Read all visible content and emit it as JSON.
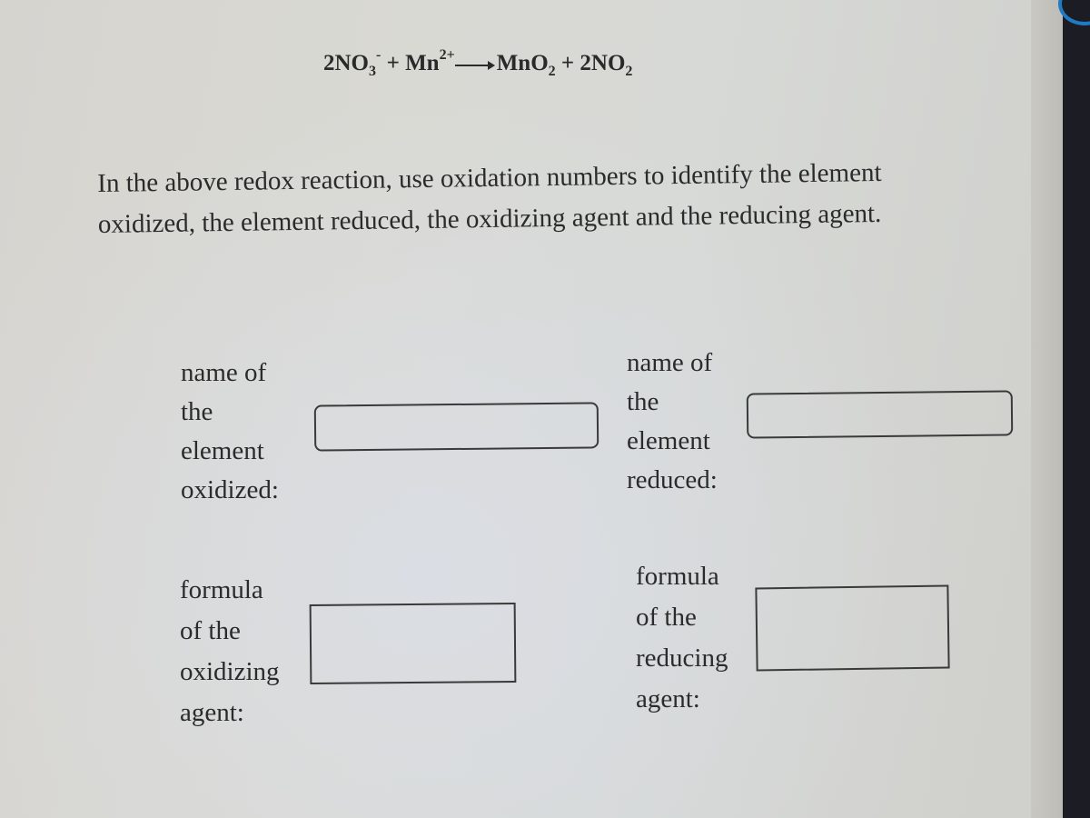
{
  "equation": {
    "reactant1_coef": "2",
    "reactant1_base": "NO",
    "reactant1_sub": "3",
    "reactant1_charge": "-",
    "plus1": "+",
    "reactant2_base": "Mn",
    "reactant2_charge": "2+",
    "product1_base": "MnO",
    "product1_sub": "2",
    "plus2": "+",
    "product2_coef": "2",
    "product2_base": "NO",
    "product2_sub": "2"
  },
  "question": {
    "text": "In the above redox reaction, use oxidation numbers to identify the element oxidized, the element reduced, the oxidizing agent and the reducing agent."
  },
  "fields": {
    "element_oxidized": {
      "label_lines": [
        "name of",
        "the",
        "element",
        "oxidized:"
      ],
      "value": ""
    },
    "element_reduced": {
      "label_lines": [
        "name of",
        "the",
        "element",
        "reduced:"
      ],
      "value": ""
    },
    "oxidizing_agent": {
      "label_lines": [
        "formula",
        "of the",
        "oxidizing",
        "agent:"
      ],
      "value": ""
    },
    "reducing_agent": {
      "label_lines": [
        "formula",
        "of the",
        "reducing",
        "agent:"
      ],
      "value": ""
    }
  },
  "colors": {
    "text": "#2b2b2b",
    "field_border": "#3a3a3a",
    "corner_badge": "#1f7bc4"
  }
}
